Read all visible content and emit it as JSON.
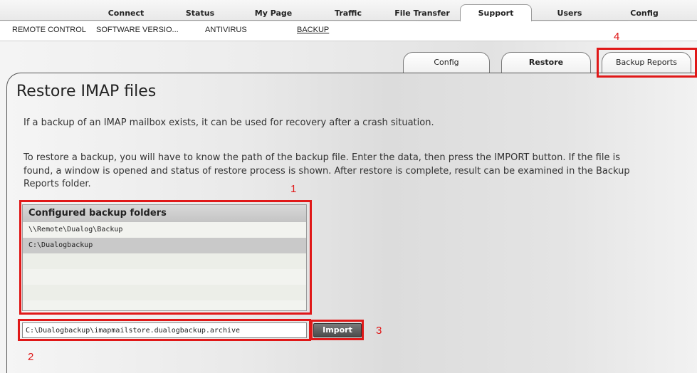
{
  "top_nav": {
    "items": [
      "Connect",
      "Status",
      "My Page",
      "Traffic",
      "File Transfer",
      "Support",
      "Users",
      "Config"
    ],
    "active": "Support"
  },
  "sub_nav": {
    "items": [
      "REMOTE CONTROL",
      "SOFTWARE VERSIO...",
      "ANTIVIRUS",
      "BACKUP"
    ],
    "active": "BACKUP"
  },
  "page_tabs": {
    "items": [
      "Config",
      "Restore",
      "Backup Reports"
    ],
    "active": "Restore"
  },
  "main": {
    "title": "Restore IMAP files",
    "intro": "If a backup of an IMAP mailbox exists, it can be used for recovery after a crash situation.",
    "instructions_line1": "To restore a backup, you will have to know the path of the backup file. Enter the data, then press the IMPORT button. If the file is",
    "instructions_line2": "found, a window is opened and status of restore process is shown. After restore is complete, result can be examined in the Backup",
    "instructions_line3": "Reports folder."
  },
  "folders": {
    "header": "Configured backup folders",
    "rows": [
      "\\\\Remote\\Dualog\\Backup",
      "C:\\Dualogbackup",
      "",
      "",
      "",
      ""
    ]
  },
  "import": {
    "path_value": "C:\\Dualogbackup\\imapmailstore.dualogbackup.archive",
    "button_label": "Import"
  },
  "annotations": {
    "1": "1",
    "2": "2",
    "3": "3",
    "4": "4",
    "color": "#e01818"
  }
}
